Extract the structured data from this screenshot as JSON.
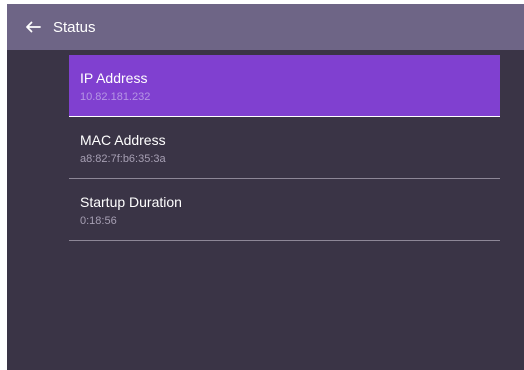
{
  "header": {
    "title": "Status",
    "back_icon": "arrow-left-icon"
  },
  "status_items": [
    {
      "label": "IP Address",
      "value": "10.82.181.232",
      "selected": true
    },
    {
      "label": "MAC Address",
      "value": "a8:82:7f:b6:35:3a",
      "selected": false
    },
    {
      "label": "Startup Duration",
      "value": "0:18:56",
      "selected": false
    }
  ],
  "colors": {
    "header_bg": "#6e6586",
    "panel_bg": "#3a3446",
    "selected_bg": "#8040d0"
  }
}
